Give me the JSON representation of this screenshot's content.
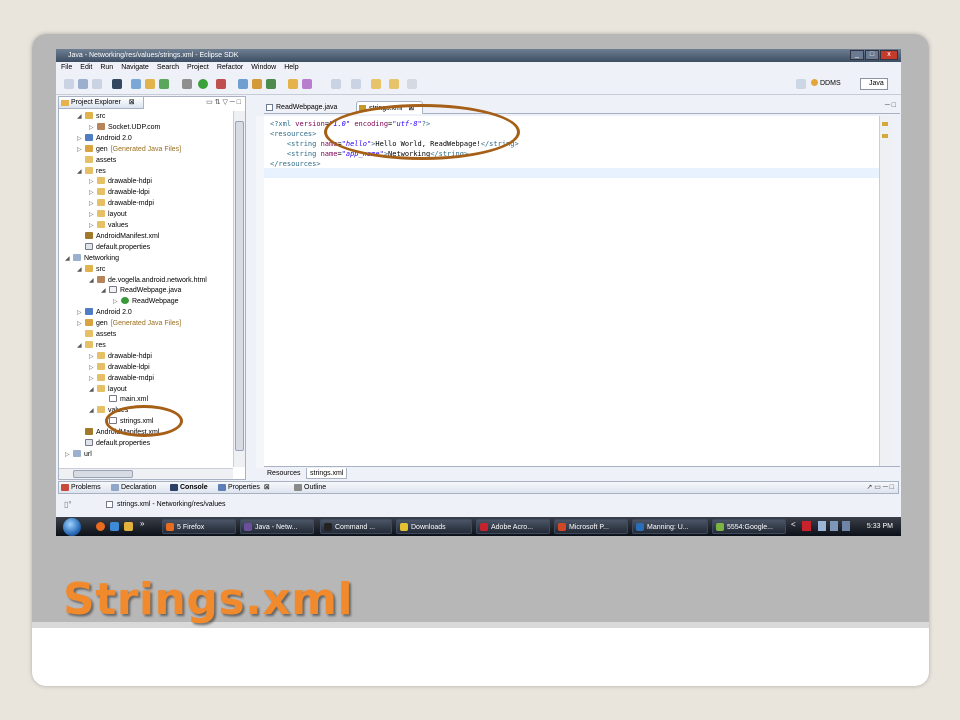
{
  "slide": {
    "title": "Strings.xml"
  },
  "window": {
    "title": "Java - Networking/res/values/strings.xml - Eclipse SDK",
    "controls": [
      "_",
      "□",
      "x"
    ]
  },
  "menu": [
    "File",
    "Edit",
    "Run",
    "Navigate",
    "Search",
    "Project",
    "Refactor",
    "Window",
    "Help"
  ],
  "perspectives": {
    "ddms": "DDMS",
    "java": "Java"
  },
  "explorer": {
    "tab": "Project Explorer",
    "tab_suffix": "⊠",
    "rows": [
      {
        "label": "src",
        "indent": 1,
        "arrow": "◢",
        "icon": "folder-src"
      },
      {
        "label": "Socket.UDP.com",
        "indent": 2,
        "arrow": "▷",
        "icon": "package"
      },
      {
        "label": "Android 2.0",
        "indent": 1,
        "arrow": "▷",
        "icon": "library"
      },
      {
        "label": "gen",
        "extra": "[Generated Java Files]",
        "indent": 1,
        "arrow": "▷",
        "icon": "folder-gen"
      },
      {
        "label": "assets",
        "indent": 1,
        "arrow": "",
        "icon": "folder"
      },
      {
        "label": "res",
        "indent": 1,
        "arrow": "◢",
        "icon": "folder"
      },
      {
        "label": "drawable-hdpi",
        "indent": 2,
        "arrow": "▷",
        "icon": "folder"
      },
      {
        "label": "drawable-ldpi",
        "indent": 2,
        "arrow": "▷",
        "icon": "folder"
      },
      {
        "label": "drawable-mdpi",
        "indent": 2,
        "arrow": "▷",
        "icon": "folder"
      },
      {
        "label": "layout",
        "indent": 2,
        "arrow": "▷",
        "icon": "folder"
      },
      {
        "label": "values",
        "indent": 2,
        "arrow": "▷",
        "icon": "folder"
      },
      {
        "label": "AndroidManifest.xml",
        "indent": 1,
        "arrow": "",
        "icon": "manifest"
      },
      {
        "label": "default.properties",
        "indent": 1,
        "arrow": "",
        "icon": "file"
      },
      {
        "label": "Networking",
        "indent": 0,
        "arrow": "◢",
        "icon": "project"
      },
      {
        "label": "src",
        "indent": 1,
        "arrow": "◢",
        "icon": "folder-src"
      },
      {
        "label": "de.vogella.android.network.html",
        "indent": 2,
        "arrow": "◢",
        "icon": "package"
      },
      {
        "label": "ReadWebpage.java",
        "indent": 3,
        "arrow": "◢",
        "icon": "java-file"
      },
      {
        "label": "ReadWebpage",
        "indent": 4,
        "arrow": "▷",
        "icon": "class"
      },
      {
        "label": "Android 2.0",
        "indent": 1,
        "arrow": "▷",
        "icon": "library"
      },
      {
        "label": "gen",
        "extra": "[Generated Java Files]",
        "indent": 1,
        "arrow": "▷",
        "icon": "folder-gen"
      },
      {
        "label": "assets",
        "indent": 1,
        "arrow": "",
        "icon": "folder"
      },
      {
        "label": "res",
        "indent": 1,
        "arrow": "◢",
        "icon": "folder"
      },
      {
        "label": "drawable-hdpi",
        "indent": 2,
        "arrow": "▷",
        "icon": "folder"
      },
      {
        "label": "drawable-ldpi",
        "indent": 2,
        "arrow": "▷",
        "icon": "folder"
      },
      {
        "label": "drawable-mdpi",
        "indent": 2,
        "arrow": "▷",
        "icon": "folder"
      },
      {
        "label": "layout",
        "indent": 2,
        "arrow": "◢",
        "icon": "folder"
      },
      {
        "label": "main.xml",
        "indent": 3,
        "arrow": "",
        "icon": "xml-file"
      },
      {
        "label": "values",
        "indent": 2,
        "arrow": "◢",
        "icon": "folder"
      },
      {
        "label": "strings.xml",
        "indent": 3,
        "arrow": "",
        "icon": "xml-file"
      },
      {
        "label": "AndroidManifest.xml",
        "indent": 1,
        "arrow": "",
        "icon": "manifest"
      },
      {
        "label": "default.properties",
        "indent": 1,
        "arrow": "",
        "icon": "file"
      },
      {
        "label": "url",
        "indent": 0,
        "arrow": "▷",
        "icon": "project"
      }
    ]
  },
  "editor": {
    "tabs": [
      {
        "label": "ReadWebpage.java",
        "icon": "java-file"
      },
      {
        "label": "strings.xml",
        "icon": "android-xml",
        "close": "⊠"
      }
    ],
    "lines": [
      [
        {
          "t": "<?xml ",
          "c": "tagc"
        },
        {
          "t": "version",
          "c": "attrc"
        },
        {
          "t": "=",
          "c": ""
        },
        {
          "t": "\"1.0\"",
          "c": "valc"
        },
        {
          "t": " ",
          "c": ""
        },
        {
          "t": "encoding",
          "c": "attrc"
        },
        {
          "t": "=",
          "c": ""
        },
        {
          "t": "\"utf-8\"",
          "c": "valc"
        },
        {
          "t": "?>",
          "c": "tagc"
        }
      ],
      [
        {
          "t": "<resources>",
          "c": "tagc"
        }
      ],
      [
        {
          "t": "    <string ",
          "c": "tagc"
        },
        {
          "t": "name",
          "c": "attrc"
        },
        {
          "t": "=",
          "c": ""
        },
        {
          "t": "\"hello\"",
          "c": "valc"
        },
        {
          "t": ">",
          "c": "tagc"
        },
        {
          "t": "Hello World, ReadWebpage!",
          "c": ""
        },
        {
          "t": "</string>",
          "c": "tagc"
        }
      ],
      [
        {
          "t": "    <string ",
          "c": "tagc"
        },
        {
          "t": "name",
          "c": "attrc"
        },
        {
          "t": "=",
          "c": ""
        },
        {
          "t": "\"app_name\"",
          "c": "valc"
        },
        {
          "t": ">",
          "c": "tagc"
        },
        {
          "t": "Networking",
          "c": ""
        },
        {
          "t": "</string>",
          "c": "tagc"
        }
      ],
      [
        {
          "t": "</resources>",
          "c": "tagc"
        }
      ]
    ],
    "bottom_tabs": [
      "Resources",
      "strings.xml"
    ]
  },
  "views": [
    "Problems",
    "Declaration",
    "Console",
    "Properties",
    "Outline"
  ],
  "status": {
    "text": "strings.xml - Networking/res/values"
  },
  "taskbar": {
    "items": [
      {
        "label": "5 Firefox",
        "color": "#e96b1f"
      },
      {
        "label": "Java - Netw...",
        "color": "#6b4f9a"
      },
      {
        "label": "Command ...",
        "color": "#222222"
      },
      {
        "label": "Downloads",
        "color": "#e6c233"
      },
      {
        "label": "Adobe Acro...",
        "color": "#c8232c"
      },
      {
        "label": "Microsoft P...",
        "color": "#d24726"
      },
      {
        "label": "Manning: U...",
        "color": "#2a6db8"
      },
      {
        "label": "5554:Google...",
        "color": "#7cb342"
      }
    ],
    "time": "5:33 PM"
  },
  "colors": {
    "title_orange": "#f08a2d",
    "highlight_circle": "#a55f17"
  }
}
